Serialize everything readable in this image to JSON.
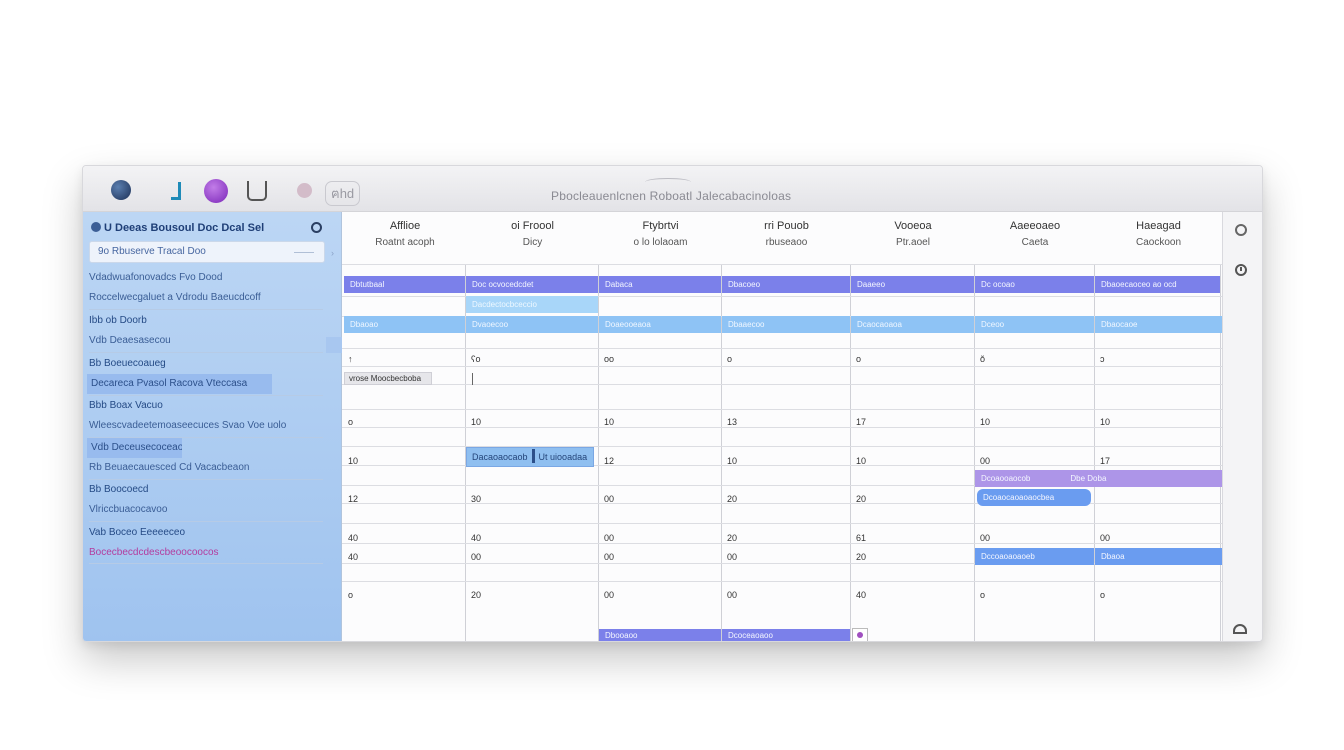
{
  "window": {
    "title": "Pbocleauenlcnen   Roboatl Jalecabacinoloas",
    "toolbar_label": "ฅhd"
  },
  "sidebar": {
    "header": "U Deeas Bousoul Doc Dcal Sel",
    "search_text": "9o  Rbuserve Tracal Doo",
    "groups": [
      {
        "lines": [
          {
            "text": "Vdadwuafonovadcs Fvo Dood",
            "style": ""
          },
          {
            "text": "Roccelwecgaluet a Vdrodu Baeucdcoff",
            "style": ""
          }
        ]
      },
      {
        "lines": [
          {
            "text": "Ibb ob Doorb",
            "style": "bold"
          },
          {
            "text": "Vdb Deaesasecou",
            "style": ""
          }
        ]
      },
      {
        "lines": [
          {
            "text": "Bb Boeuecoaueg",
            "style": "bold"
          },
          {
            "text": "Decareca Pvasol Racova Vteccasa",
            "style": "sel"
          }
        ]
      },
      {
        "lines": [
          {
            "text": "Bbb Boax Vacuo",
            "style": "bold"
          },
          {
            "text": "Wleescvadeetemoaseecuces Svao Voe uolo",
            "style": ""
          }
        ]
      },
      {
        "lines": [
          {
            "text": "Vdb Deceusecoceao",
            "style": "sel"
          },
          {
            "text": "Rb Beuaecauesced Cd Vacacbeaon",
            "style": ""
          }
        ]
      },
      {
        "lines": [
          {
            "text": "Bb Boocoecd",
            "style": "bold"
          },
          {
            "text": "Vlriccbuacocavoo",
            "style": ""
          }
        ]
      },
      {
        "lines": [
          {
            "text": "Vab Boceo Eeeeeceo",
            "style": "bold"
          },
          {
            "text": "Bocecbecdcdescbeoocoocos",
            "style": "pink"
          }
        ]
      }
    ]
  },
  "calendar": {
    "days": [
      {
        "name": "Afflioe",
        "sub": "Roatnt acoph"
      },
      {
        "name": "oi Froool",
        "sub": "Dicy"
      },
      {
        "name": "Ftybrtvi",
        "sub": "o lo lolaoam"
      },
      {
        "name": "rri Pouob",
        "sub": "rbuseaoo"
      },
      {
        "name": "Vooeoa",
        "sub": "Ptr.aoel"
      },
      {
        "name": "Aaeeoaeo",
        "sub": "Caeta"
      },
      {
        "name": "Haeagad",
        "sub": "Caockoon"
      }
    ],
    "rows": [
      [
        "↑",
        "ʕo",
        "oo",
        "o",
        "o",
        "ŏ",
        "ɔ"
      ],
      [
        "o",
        "10",
        "10",
        "13",
        "17",
        "10",
        "10"
      ],
      [
        "10",
        "",
        "12",
        "10",
        "10",
        "00",
        "17"
      ],
      [
        "12",
        "30",
        "00",
        "20",
        "20",
        "",
        ""
      ],
      [
        "40",
        "40",
        "00",
        "20",
        "61",
        "00",
        "00"
      ],
      [
        "40",
        "00",
        "00",
        "00",
        "20",
        "00",
        "20"
      ],
      [
        "o",
        "20",
        "00",
        "00",
        "40",
        "o",
        "o"
      ]
    ],
    "events": {
      "row1": [
        "Dbtutbaal",
        "Doc ocvocedcdet",
        "Dabaca",
        "Dbacoeo",
        "Daaeeo",
        "Dc ocoao",
        "Dbaoecaoceo ao ocd"
      ],
      "row1b": "Dacdectocbceccio",
      "row2": [
        "Dbaoao",
        "Dvaoecoo",
        "Doaeooeaoa",
        "Dbaaecoo",
        "Dcaocaoaoa",
        "Dceoo",
        "Dbaocaoe"
      ],
      "tag": "vrose Moocbecboba",
      "box_left": "Dacaoaocaob",
      "box_right": "Ut uiooadaa",
      "purple_left": "Dcoaooaocob",
      "purple_right": "Dbe  Doba",
      "pill_blue": "Dcoaocaoaoaocbea",
      "lower_left": "Dccoaoaoaoeb",
      "lower_right": "Dbaoa",
      "bottom_left": "Dbooaoo",
      "bottom_right": "Dcoceaoaoo"
    }
  }
}
